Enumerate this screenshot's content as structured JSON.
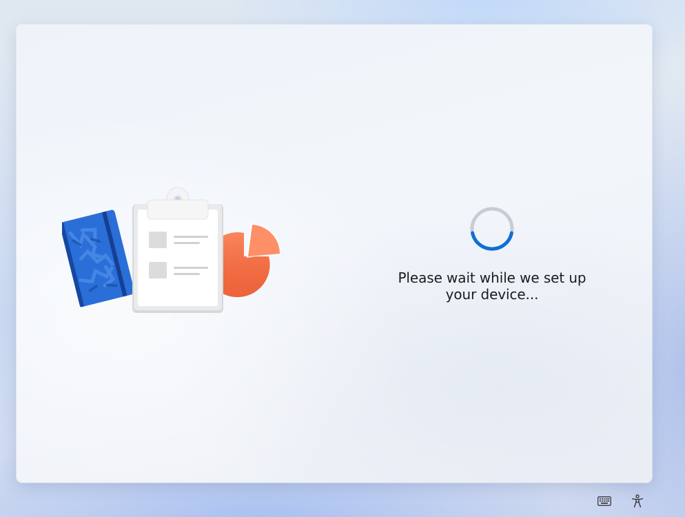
{
  "setup": {
    "message": "Please wait while we set up your device..."
  },
  "illustration": {
    "items": [
      "notebook-icon",
      "clipboard-icon",
      "pie-chart-icon"
    ]
  },
  "footer": {
    "icons": [
      "keyboard-icon",
      "accessibility-icon"
    ]
  },
  "colors": {
    "spinner_track": "#c9ccd2",
    "spinner_active": "#0f6fd6",
    "notebook_blue": "#1d5fc9",
    "pie_orange": "#f36f45",
    "text": "#1b1b1b"
  }
}
